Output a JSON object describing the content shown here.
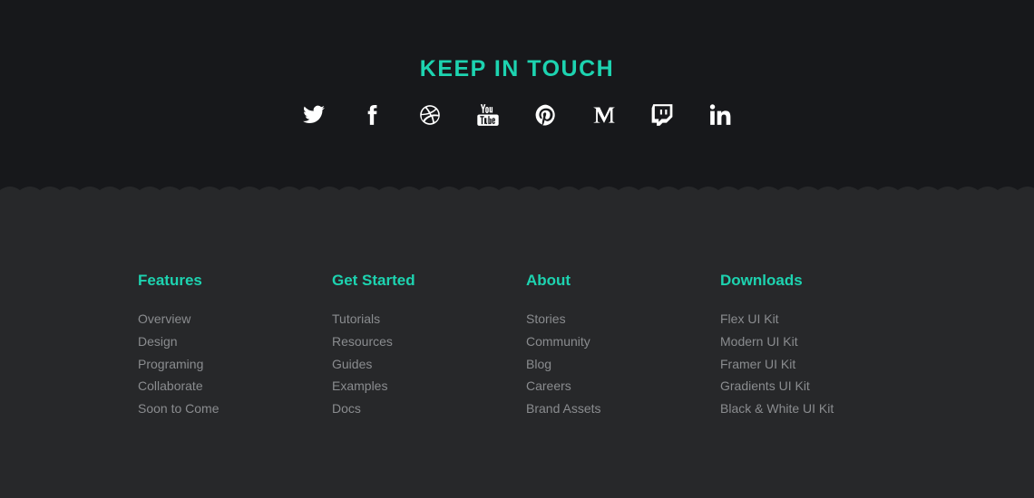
{
  "keep_in_touch": {
    "title": "KEEP IN TOUCH",
    "accent_color": "#1dd3b0",
    "icons": [
      "twitter-icon",
      "facebook-icon",
      "dribbble-icon",
      "youtube-icon",
      "pinterest-icon",
      "medium-icon",
      "twitch-icon",
      "linkedin-icon"
    ]
  },
  "footer": {
    "columns": [
      {
        "heading": "Features",
        "links": [
          "Overview",
          "Design",
          "Programing",
          "Collaborate",
          "Soon to Come"
        ]
      },
      {
        "heading": "Get Started",
        "links": [
          "Tutorials",
          "Resources",
          "Guides",
          "Examples",
          "Docs"
        ]
      },
      {
        "heading": "About",
        "links": [
          "Stories",
          "Community",
          "Blog",
          "Careers",
          "Brand Assets"
        ]
      },
      {
        "heading": "Downloads",
        "links": [
          "Flex UI Kit",
          "Modern UI Kit",
          "Framer UI Kit",
          "Gradients UI Kit",
          "Black & White UI Kit"
        ]
      }
    ]
  }
}
